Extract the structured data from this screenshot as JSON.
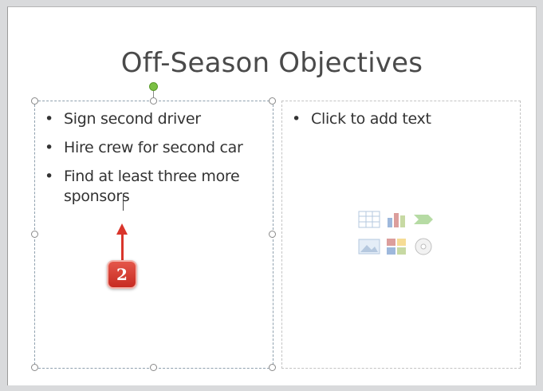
{
  "slide": {
    "title": "Off-Season Objectives",
    "left_bullets": [
      "Sign second driver",
      "Hire crew for second car",
      "Find at least three more sponsors"
    ],
    "right_placeholder": "Click to add text"
  },
  "callout": {
    "step": "2"
  },
  "content_icons": [
    "table-icon",
    "chart-icon",
    "smartart-icon",
    "picture-icon",
    "clipart-icon",
    "media-icon"
  ],
  "colors": {
    "arrow": "#d9352b",
    "rotation_handle": "#7bc043"
  }
}
